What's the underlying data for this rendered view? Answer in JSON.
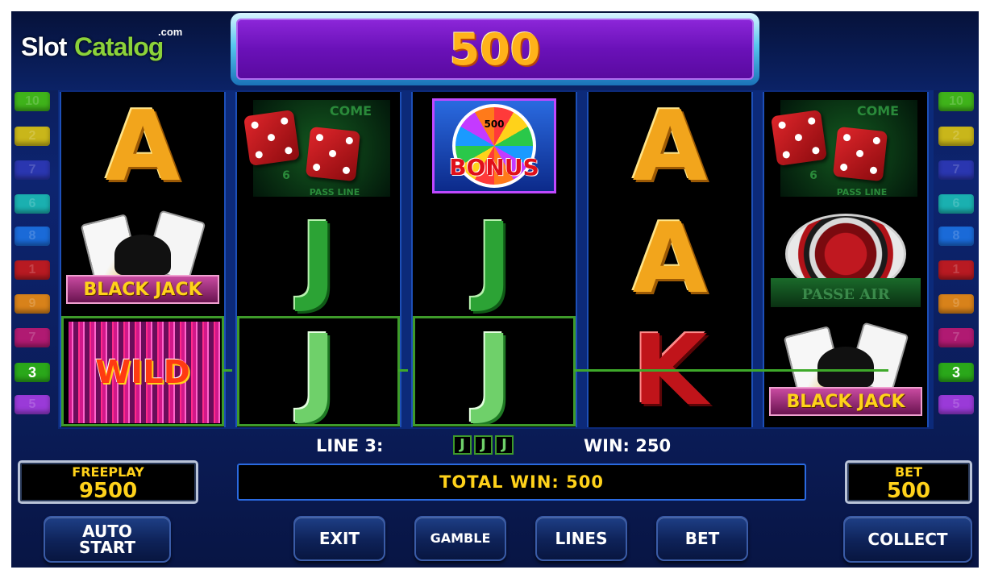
{
  "brand": {
    "logo_part1": "Slot",
    "logo_part2": "Catalog",
    "logo_suffix": ".com"
  },
  "top_display": {
    "value": "500"
  },
  "line_indicators": {
    "left": [
      {
        "label": "10",
        "color": "#3fb31a"
      },
      {
        "label": "2",
        "color": "#c9b61a"
      },
      {
        "label": "7",
        "color": "#2a36b0"
      },
      {
        "label": "6",
        "color": "#1ab0b0"
      },
      {
        "label": "8",
        "color": "#1a6ad8"
      },
      {
        "label": "1",
        "color": "#b81a22"
      },
      {
        "label": "9",
        "color": "#d8821a"
      },
      {
        "label": "7",
        "color": "#b01a72"
      },
      {
        "label": "3",
        "color": "#2aa81a",
        "active": true
      },
      {
        "label": "5",
        "color": "#9a3ad8"
      }
    ],
    "right": [
      {
        "label": "10",
        "color": "#3fb31a"
      },
      {
        "label": "2",
        "color": "#c9b61a"
      },
      {
        "label": "7",
        "color": "#2a36b0"
      },
      {
        "label": "6",
        "color": "#1ab0b0"
      },
      {
        "label": "8",
        "color": "#1a6ad8"
      },
      {
        "label": "1",
        "color": "#b81a22"
      },
      {
        "label": "9",
        "color": "#d8821a"
      },
      {
        "label": "7",
        "color": "#b01a72"
      },
      {
        "label": "3",
        "color": "#2aa81a",
        "active": true
      },
      {
        "label": "5",
        "color": "#9a3ad8"
      }
    ]
  },
  "reels": [
    [
      "ace",
      "blackjack",
      "wild"
    ],
    [
      "dice",
      "jack",
      "jack"
    ],
    [
      "bonus",
      "jack",
      "jack"
    ],
    [
      "ace",
      "ace",
      "king"
    ],
    [
      "dice",
      "roulette",
      "blackjack"
    ]
  ],
  "symbols": {
    "ace": "A",
    "jack": "J",
    "king": "K",
    "wild": "WILD",
    "bonus": "BONUS",
    "bonus_wheel_value": "500",
    "blackjack": "BLACK JACK",
    "dice_come": "COME",
    "dice_pass": "PASS LINE",
    "dice_six": "6",
    "roulette_text": "PASSE  AIR"
  },
  "winning_cells": [
    [
      0,
      2
    ],
    [
      1,
      2
    ],
    [
      2,
      2
    ]
  ],
  "win_info": {
    "line_label": "LINE 3:",
    "win_label": "WIN: 250",
    "mini_symbols": [
      "J",
      "J",
      "J"
    ]
  },
  "freeplay": {
    "label": "FREEPLAY",
    "value": "9500"
  },
  "total_win": {
    "label": "TOTAL WIN: 500"
  },
  "bet": {
    "label": "BET",
    "value": "500"
  },
  "buttons": {
    "auto_start_line1": "AUTO",
    "auto_start_line2": "START",
    "exit": "EXIT",
    "gamble": "GAMBLE",
    "lines": "LINES",
    "bet": "BET",
    "collect": "COLLECT"
  },
  "colors": {
    "payline": "#3ea92a",
    "display_purple": "#6a11b8",
    "gold_text": "#ffd21a"
  }
}
